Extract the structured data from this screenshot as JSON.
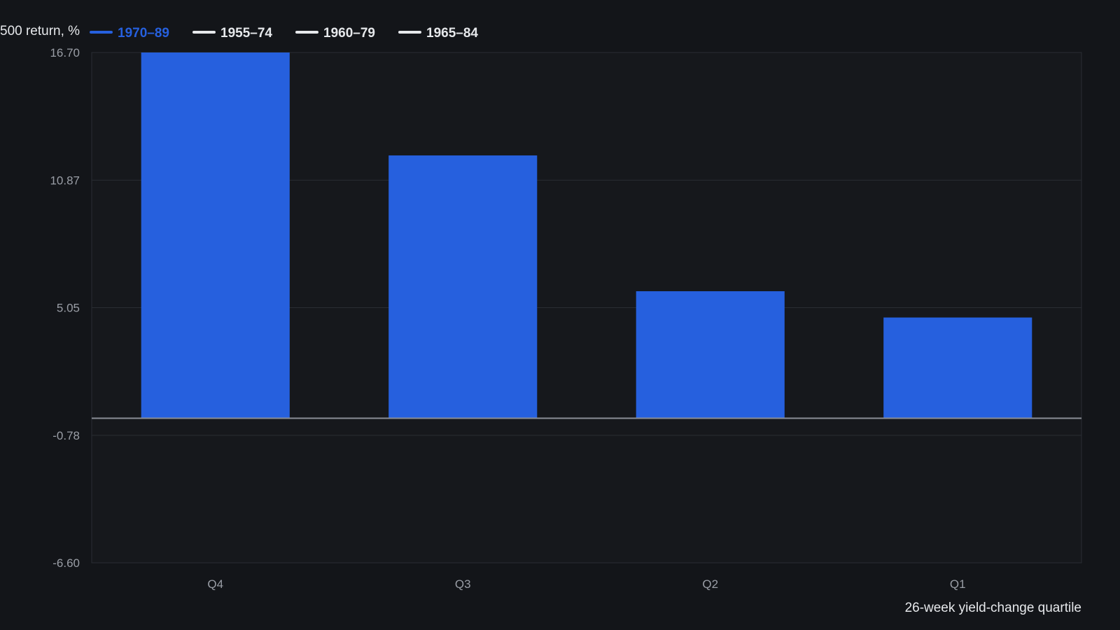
{
  "chart_data": {
    "type": "bar",
    "title": "",
    "ylabel": "500 return, %",
    "xlabel": "26-week yield-change quartile",
    "categories": [
      "Q4",
      "Q3",
      "Q2",
      "Q1"
    ],
    "ylim": [
      -6.6,
      16.7
    ],
    "yticks": [
      "16.70",
      "10.87",
      "5.05",
      "-0.78",
      "-6.60"
    ],
    "ytick_values": [
      16.7,
      10.87,
      5.05,
      -0.78,
      -6.6
    ],
    "grid": true,
    "legend_position": "top-left",
    "series": [
      {
        "name": "1970–89",
        "values": [
          16.7,
          12.0,
          5.8,
          4.6
        ],
        "color": "#2660de",
        "active": true
      },
      {
        "name": "1955–74",
        "values": [],
        "color": "#e6e8eb",
        "active": false
      },
      {
        "name": "1960–79",
        "values": [],
        "color": "#e6e8eb",
        "active": false
      },
      {
        "name": "1965–84",
        "values": [],
        "color": "#e6e8eb",
        "active": false
      }
    ],
    "colors": {
      "background": "#131519",
      "plot_background": "#16181c",
      "grid": "#2a2d33",
      "zero_line": "#8a8e96",
      "tick_text": "#9a9ea6",
      "label_text": "#e6e8eb"
    }
  }
}
